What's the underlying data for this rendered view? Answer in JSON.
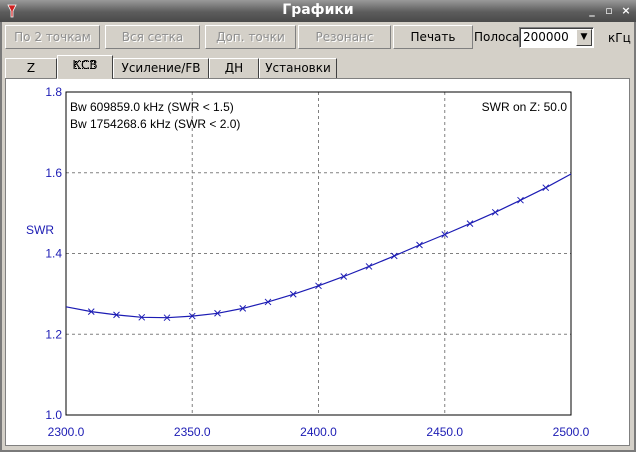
{
  "window": {
    "title": "Графики"
  },
  "toolbar": {
    "btn_two_points": "По 2 точкам",
    "btn_full_grid": "Вся сетка",
    "btn_extra_points": "Доп. точки",
    "btn_resonance": "Резонанс",
    "btn_print": "Печать",
    "bandwidth_label": "Полоса",
    "bandwidth_value": "200000",
    "unit_label": "кГц"
  },
  "tabs": [
    {
      "label": "Z"
    },
    {
      "label": "КСВ"
    },
    {
      "label": "Усиление/FB"
    },
    {
      "label": "ДН"
    },
    {
      "label": "Установки"
    }
  ],
  "colors": {
    "series": "#1c1cb4",
    "axis_text": "#1c1cb4",
    "grid": "#808080"
  },
  "chart_data": {
    "type": "line",
    "ylabel": "SWR",
    "xlabel": "",
    "xlim": [
      2300,
      2500
    ],
    "ylim": [
      1.0,
      1.8
    ],
    "x_ticks": [
      2300,
      2350,
      2400,
      2450,
      2500
    ],
    "x_tick_labels": [
      "2300.0",
      "2350.0",
      "2400.0",
      "2450.0",
      "2500.0"
    ],
    "y_ticks": [
      1.0,
      1.2,
      1.4,
      1.6,
      1.8
    ],
    "y_tick_labels": [
      "1.0",
      "1.2",
      "1.4",
      "1.6",
      "1.8"
    ],
    "grid": true,
    "annotations": [
      "Bw 609859.0 kHz (SWR < 1.5)",
      "Bw 1754268.6 kHz (SWR < 2.0)",
      "SWR on Z: 50.0"
    ],
    "series": [
      {
        "x": [
          2300,
          2310,
          2320,
          2330,
          2340,
          2350,
          2360,
          2370,
          2380,
          2390,
          2400,
          2410,
          2420,
          2430,
          2440,
          2450,
          2460,
          2470,
          2480,
          2490,
          2500
        ],
        "y": [
          1.268,
          1.256,
          1.248,
          1.242,
          1.241,
          1.245,
          1.252,
          1.264,
          1.28,
          1.299,
          1.32,
          1.343,
          1.368,
          1.394,
          1.421,
          1.447,
          1.474,
          1.502,
          1.532,
          1.563,
          1.597
        ]
      }
    ]
  }
}
